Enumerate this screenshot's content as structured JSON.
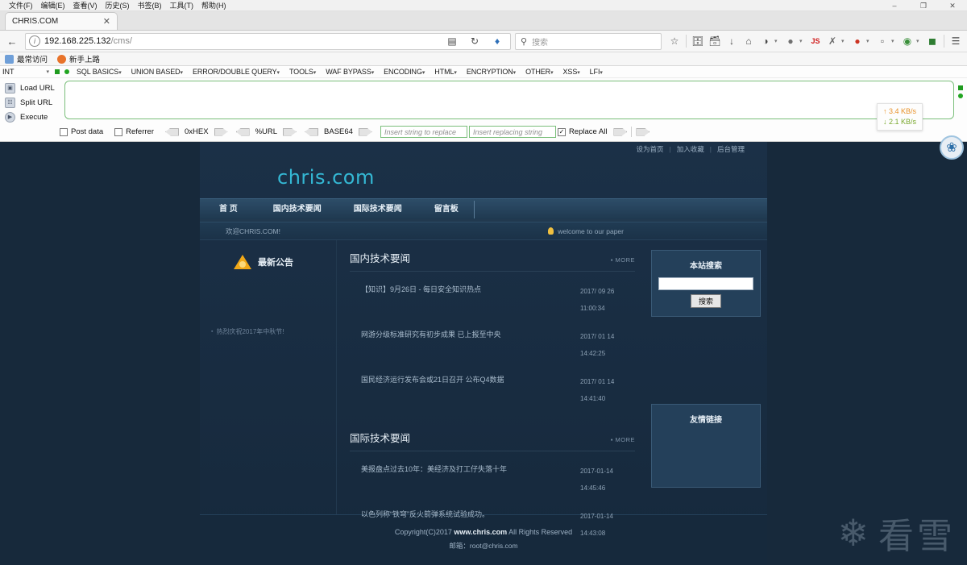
{
  "window": {
    "menus": [
      {
        "label": "文件(F)"
      },
      {
        "label": "编辑(E)"
      },
      {
        "label": "查看(V)"
      },
      {
        "label": "历史(S)"
      },
      {
        "label": "书签(B)"
      },
      {
        "label": "工具(T)"
      },
      {
        "label": "帮助(H)"
      }
    ],
    "controls": {
      "minimize": "–",
      "maximize": "❐",
      "close": "✕"
    }
  },
  "browser": {
    "tab": {
      "title": "CHRIS.COM",
      "close": "✕"
    },
    "back_icon": "←",
    "url": {
      "host": "192.168.225.132",
      "path": "/cms/",
      "info_icon": "i"
    },
    "url_right_icons": [
      "reader-icon",
      "reload-icon",
      "pocket-icon"
    ],
    "search": {
      "placeholder": "搜索",
      "icon": "⚲"
    },
    "toolbar_icons": [
      {
        "name": "bookmark-star-icon",
        "glyph": "☆"
      },
      {
        "name": "library-icon",
        "glyph": "☰"
      },
      {
        "name": "save-page-icon",
        "glyph": "⬛"
      },
      {
        "name": "downloads-icon",
        "glyph": "↓"
      },
      {
        "name": "home-icon",
        "glyph": "⌂"
      },
      {
        "name": "palette-icon",
        "glyph": "◑"
      },
      {
        "name": "globe-icon",
        "glyph": "●"
      },
      {
        "name": "javascript-toggle-icon",
        "glyph": "JS"
      },
      {
        "name": "plug-icon",
        "glyph": "✂"
      },
      {
        "name": "cookie-icon",
        "glyph": "●"
      },
      {
        "name": "proxy-icon",
        "glyph": "□"
      },
      {
        "name": "world-icon",
        "glyph": "◕"
      },
      {
        "name": "shield-icon",
        "glyph": "⬟"
      },
      {
        "name": "menu-icon",
        "glyph": "☰"
      }
    ],
    "bookmarks": [
      {
        "label": "最常访问",
        "color": "#6f9fd8"
      },
      {
        "label": "新手上路",
        "color": "#e8732a"
      }
    ]
  },
  "hackbar": {
    "mode_select": {
      "value": "INT",
      "caret": "▾"
    },
    "menus": [
      {
        "label": "SQL BASICS"
      },
      {
        "label": "UNION BASED"
      },
      {
        "label": "ERROR/DOUBLE QUERY"
      },
      {
        "label": "TOOLS"
      },
      {
        "label": "WAF BYPASS"
      },
      {
        "label": "ENCODING"
      },
      {
        "label": "HTML"
      },
      {
        "label": "ENCRYPTION"
      },
      {
        "label": "OTHER"
      },
      {
        "label": "XSS"
      },
      {
        "label": "LFI"
      }
    ],
    "actions": [
      {
        "label": "Load URL",
        "icon": "load-url-icon"
      },
      {
        "label": "Split URL",
        "icon": "split-url-icon"
      },
      {
        "label": "Execute",
        "icon": "execute-icon"
      }
    ],
    "url_textarea_value": "",
    "options": {
      "post_data": {
        "label": "Post data",
        "checked": false
      },
      "referrer": {
        "label": "Referrer",
        "checked": false
      },
      "encoders": [
        {
          "label": "0xHEX"
        },
        {
          "label": "%URL"
        },
        {
          "label": "BASE64"
        }
      ],
      "search_placeholder": "Insert string to replace",
      "replace_placeholder": "Insert replacing string",
      "replace_all": {
        "label": "Replace All",
        "checked": true,
        "mark": "✓"
      }
    }
  },
  "netspeed": {
    "upload": "↑ 3.4 KB/s",
    "download": "↓ 2.1 KB/s"
  },
  "float_badge": {
    "icon": "ublock-icon",
    "glyph": "⬣"
  },
  "site": {
    "toplinks": [
      {
        "label": "设为首页"
      },
      {
        "label": "加入收藏"
      },
      {
        "label": "后台管理"
      }
    ],
    "separator": "|",
    "logo": "chris.com",
    "nav": [
      {
        "label": "首 页"
      },
      {
        "label": "国内技术要闻"
      },
      {
        "label": "国际技术要闻"
      },
      {
        "label": "留言板"
      }
    ],
    "welcome_left": "欢迎CHRIS.COM!",
    "welcome_right": "welcome to our paper",
    "notice": {
      "title": "最新公告",
      "items": [
        {
          "label": "热烈庆祝2017年中秋节!",
          "bullet": "▪"
        }
      ]
    },
    "news_sections": [
      {
        "title": "国内技术要闻",
        "more": "▪ MORE",
        "rows": [
          {
            "title": "【知识】9月26日 - 每日安全知识热点",
            "date": "2017/ 09  26",
            "time": "11:00:34"
          },
          {
            "title": "网游分级标准研究有初步成果  已上报至中央",
            "date": "2017/ 01  14",
            "time": "14:42:25"
          },
          {
            "title": "国民经济运行发布会或21日召开 公布Q4数据",
            "date": "2017/ 01  14",
            "time": "14:41:40"
          }
        ]
      },
      {
        "title": "国际技术要闻",
        "more": "▪ MORE",
        "rows": [
          {
            "title": "美报盘点过去10年：美经济及打工仔失落十年",
            "date": "2017-01-14",
            "time": "14:45:46"
          },
          {
            "title": "以色列称“铁穹”反火箭弹系统试验成功。",
            "date": "2017-01-14",
            "time": "14:43:08"
          }
        ]
      }
    ],
    "search_panel": {
      "title": "本站搜索",
      "input_value": "",
      "button": "搜索"
    },
    "links_panel": {
      "title": "友情链接"
    },
    "footer": {
      "copyright_prefix": "Copyright(C)2017 ",
      "copyright_site": "www.chris.com",
      "copyright_suffix": " All Rights Reserved",
      "email": "邮箱：root@chris.com"
    }
  },
  "watermark": {
    "text": "看雪",
    "icon": "snowflake-icon",
    "glyph": "❄"
  }
}
